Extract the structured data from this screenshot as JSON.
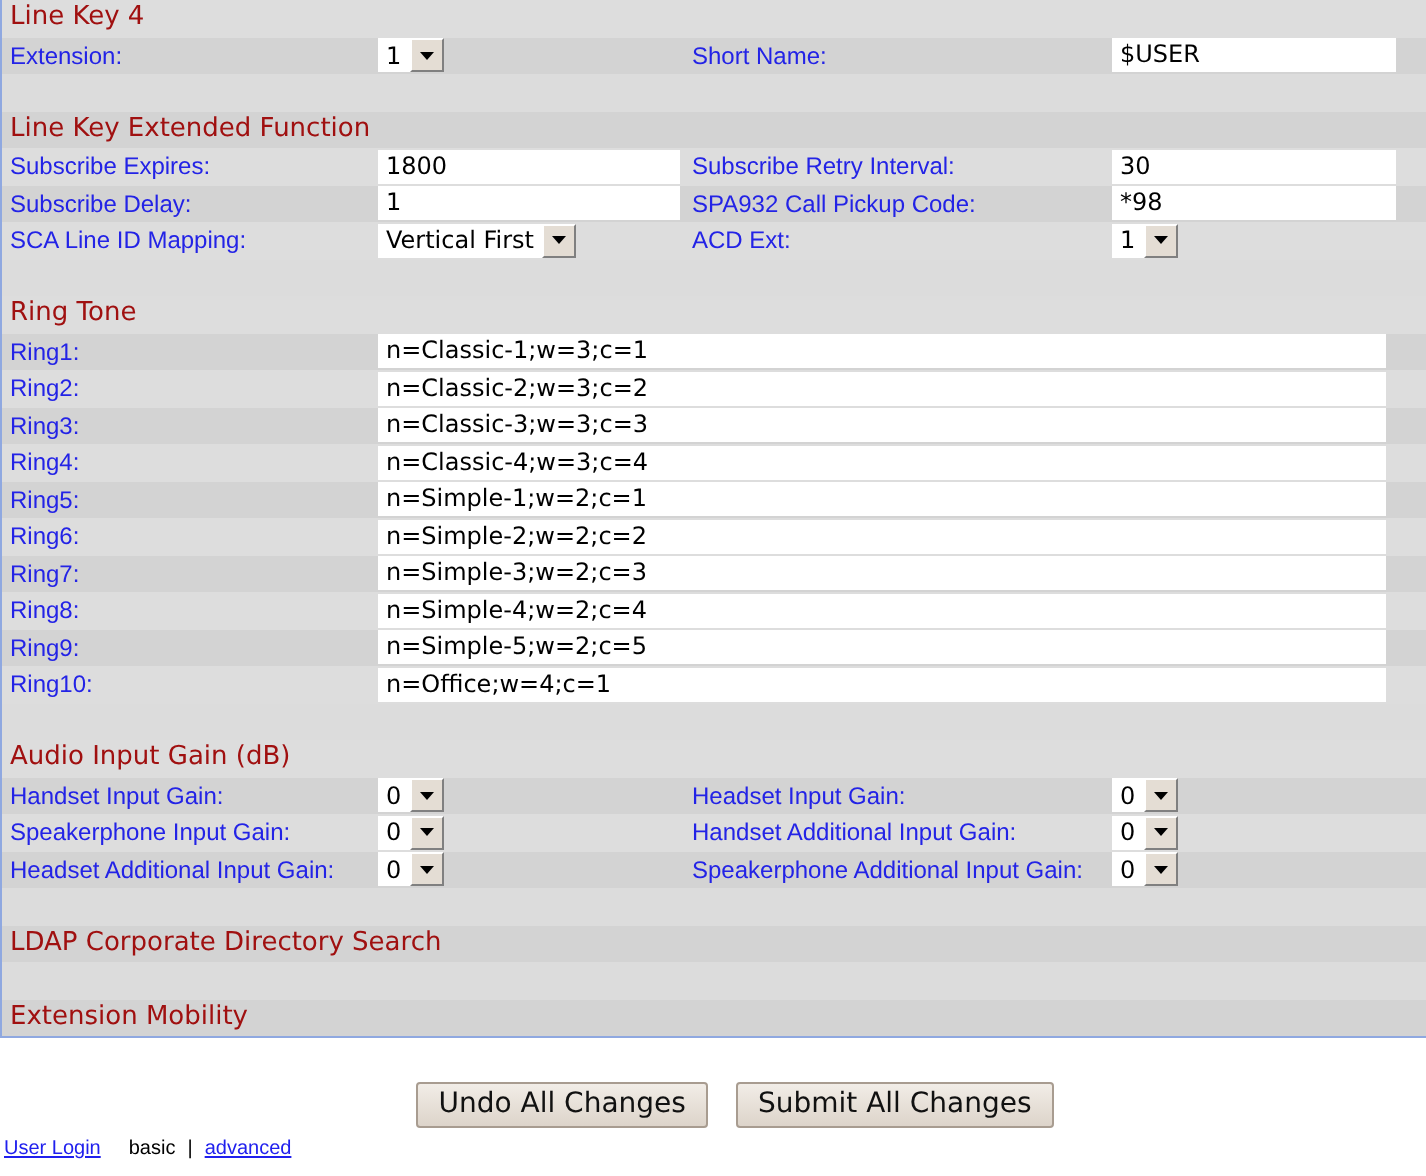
{
  "sections": [
    {
      "title": "Line Key 4",
      "rows": [
        {
          "kind": "pair",
          "fields": [
            {
              "label": "Extension:",
              "kind": "select",
              "value": "1"
            },
            {
              "label": "Short Name:",
              "kind": "text",
              "value": "$USER"
            }
          ]
        }
      ]
    },
    {
      "title": "Line Key Extended Function",
      "rows": [
        {
          "kind": "pair",
          "fields": [
            {
              "label": "Subscribe Expires:",
              "kind": "text",
              "value": "1800"
            },
            {
              "label": "Subscribe Retry Interval:",
              "kind": "text",
              "value": "30"
            }
          ]
        },
        {
          "kind": "pair",
          "fields": [
            {
              "label": "Subscribe Delay:",
              "kind": "text",
              "value": "1"
            },
            {
              "label": "SPA932 Call Pickup Code:",
              "kind": "text",
              "value": "*98"
            }
          ]
        },
        {
          "kind": "pair",
          "fields": [
            {
              "label": "SCA Line ID Mapping:",
              "kind": "select",
              "value": "Vertical First"
            },
            {
              "label": "ACD Ext:",
              "kind": "select",
              "value": "1"
            }
          ]
        }
      ]
    },
    {
      "title": "Ring Tone",
      "rows": [
        {
          "kind": "wide",
          "label": "Ring1:",
          "value": "n=Classic-1;w=3;c=1"
        },
        {
          "kind": "wide",
          "label": "Ring2:",
          "value": "n=Classic-2;w=3;c=2"
        },
        {
          "kind": "wide",
          "label": "Ring3:",
          "value": "n=Classic-3;w=3;c=3"
        },
        {
          "kind": "wide",
          "label": "Ring4:",
          "value": "n=Classic-4;w=3;c=4"
        },
        {
          "kind": "wide",
          "label": "Ring5:",
          "value": "n=Simple-1;w=2;c=1"
        },
        {
          "kind": "wide",
          "label": "Ring6:",
          "value": "n=Simple-2;w=2;c=2"
        },
        {
          "kind": "wide",
          "label": "Ring7:",
          "value": "n=Simple-3;w=2;c=3"
        },
        {
          "kind": "wide",
          "label": "Ring8:",
          "value": "n=Simple-4;w=2;c=4"
        },
        {
          "kind": "wide",
          "label": "Ring9:",
          "value": "n=Simple-5;w=2;c=5"
        },
        {
          "kind": "wide",
          "label": "Ring10:",
          "value": "n=Office;w=4;c=1"
        }
      ]
    },
    {
      "title": "Audio Input Gain (dB)",
      "rows": [
        {
          "kind": "pair",
          "fields": [
            {
              "label": "Handset Input Gain:",
              "kind": "select",
              "value": "0"
            },
            {
              "label": "Headset Input Gain:",
              "kind": "select",
              "value": "0"
            }
          ]
        },
        {
          "kind": "pair",
          "fields": [
            {
              "label": "Speakerphone Input Gain:",
              "kind": "select",
              "value": "0"
            },
            {
              "label": "Handset Additional Input Gain:",
              "kind": "select",
              "value": "0"
            }
          ]
        },
        {
          "kind": "pair",
          "fields": [
            {
              "label": "Headset Additional Input Gain:",
              "kind": "select",
              "value": "0"
            },
            {
              "label": "Speakerphone Additional Input Gain:",
              "kind": "select",
              "value": "0"
            }
          ]
        }
      ]
    },
    {
      "title": "LDAP Corporate Directory Search"
    },
    {
      "title": "Extension Mobility"
    }
  ],
  "buttons": [
    "Undo All Changes",
    "Submit All Changes"
  ],
  "footer": {
    "login_link": "User Login",
    "modes": [
      {
        "label": "basic",
        "selected": true
      },
      {
        "label": "advanced",
        "selected": false
      }
    ],
    "separator": "|"
  }
}
